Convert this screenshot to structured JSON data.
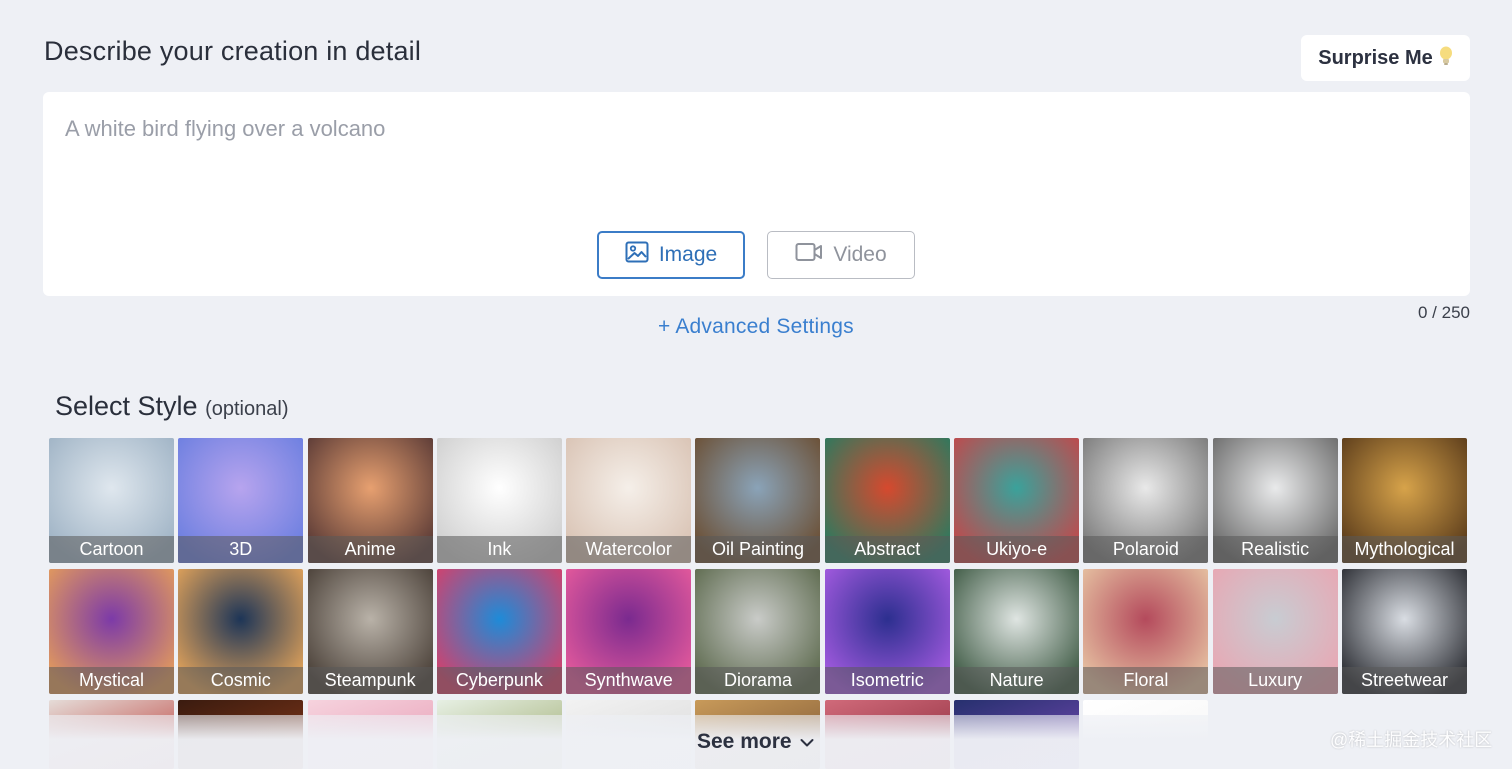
{
  "header": {
    "title": "Describe your creation in detail",
    "surprise_label": "Surprise Me",
    "surprise_icon": "lightbulb-icon"
  },
  "prompt": {
    "placeholder": "A white bird flying over a volcano",
    "value": "",
    "counter": "0 / 250"
  },
  "modes": {
    "image_label": "Image",
    "video_label": "Video",
    "selected": "Image"
  },
  "advanced_label": "+ Advanced Settings",
  "styles": {
    "title": "Select Style",
    "subtitle": "(optional)",
    "items": [
      {
        "label": "Cartoon",
        "c1": "#dfe7ee",
        "c2": "#9fb3c5"
      },
      {
        "label": "3D",
        "c1": "#b7a4ee",
        "c2": "#6c7fe0"
      },
      {
        "label": "Anime",
        "c1": "#e7a070",
        "c2": "#5a3a36"
      },
      {
        "label": "Ink",
        "c1": "#ffffff",
        "c2": "#cfcfcf"
      },
      {
        "label": "Watercolor",
        "c1": "#f5efe9",
        "c2": "#d9c3b4"
      },
      {
        "label": "Oil Painting",
        "c1": "#8aa3b8",
        "c2": "#6b4f34"
      },
      {
        "label": "Abstract",
        "c1": "#d6492e",
        "c2": "#2b7a5f"
      },
      {
        "label": "Ukiyo-e",
        "c1": "#3aa29b",
        "c2": "#c2484b"
      },
      {
        "label": "Polaroid",
        "c1": "#e9e9e9",
        "c2": "#7a7a7a"
      },
      {
        "label": "Realistic",
        "c1": "#e9eaeb",
        "c2": "#6b6b6b"
      },
      {
        "label": "Mythological",
        "c1": "#d7a34a",
        "c2": "#5b3c1b"
      },
      {
        "label": "Mystical",
        "c1": "#7c3aa8",
        "c2": "#e39b5c"
      },
      {
        "label": "Cosmic",
        "c1": "#1d3557",
        "c2": "#e2a35a"
      },
      {
        "label": "Steampunk",
        "c1": "#b9b2a8",
        "c2": "#4a4038"
      },
      {
        "label": "Cyberpunk",
        "c1": "#1e8bd8",
        "c2": "#d5406b"
      },
      {
        "label": "Synthwave",
        "c1": "#7a2a8f",
        "c2": "#e55a9c"
      },
      {
        "label": "Diorama",
        "c1": "#c9cbc8",
        "c2": "#5d6a4e"
      },
      {
        "label": "Isometric",
        "c1": "#2c2f8f",
        "c2": "#a45be0"
      },
      {
        "label": "Nature",
        "c1": "#dfe5e2",
        "c2": "#3e5a44"
      },
      {
        "label": "Floral",
        "c1": "#b44a5c",
        "c2": "#e6c2a2"
      },
      {
        "label": "Luxury",
        "c1": "#c8ccd2",
        "c2": "#e8a7b3"
      },
      {
        "label": "Streetwear",
        "c1": "#d9dde3",
        "c2": "#2b2d33"
      }
    ],
    "row3": [
      {
        "c1": "#e5dcd8",
        "c2": "#b9342f"
      },
      {
        "c1": "#3a1b0f",
        "c2": "#8a3a1a"
      },
      {
        "c1": "#f6d3de",
        "c2": "#e69ab2"
      },
      {
        "c1": "#e7f0e4",
        "c2": "#9aa86b"
      },
      {
        "c1": "#f2f2f2",
        "c2": "#d9d9d9"
      },
      {
        "c1": "#c89a5a",
        "c2": "#7a5432"
      },
      {
        "c1": "#d06a7a",
        "c2": "#8a2a3a"
      },
      {
        "c1": "#26306e",
        "c2": "#7a4bb8"
      },
      {
        "c1": "#ffffff",
        "c2": "#f5f5f5"
      }
    ]
  },
  "see_more_label": "See more",
  "watermark": "@稀土掘金技术社区"
}
